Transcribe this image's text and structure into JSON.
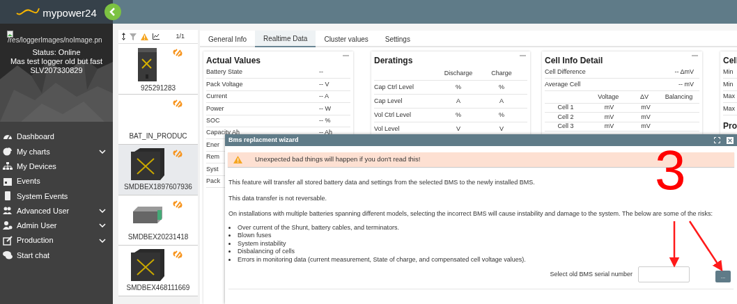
{
  "logo": {
    "text": "mypower24"
  },
  "profile": {
    "image_alt": "/res/loggerImages/noImage.pn",
    "status": "Status: Online",
    "name": "Mas test logger old but fast",
    "serial": "SLV207330829"
  },
  "sidebar": {
    "items": [
      {
        "label": "Dashboard",
        "expandable": false
      },
      {
        "label": "My charts",
        "expandable": true
      },
      {
        "label": "My Devices",
        "expandable": false
      },
      {
        "label": "Events",
        "expandable": false
      },
      {
        "label": "System Events",
        "expandable": false
      },
      {
        "label": "Advanced User",
        "expandable": true
      },
      {
        "label": "Admin User",
        "expandable": true
      },
      {
        "label": "Production",
        "expandable": true
      },
      {
        "label": "Start chat",
        "expandable": false
      }
    ]
  },
  "device_list": {
    "page": "1/1",
    "devices": [
      {
        "name": "925291283",
        "selected": false
      },
      {
        "name": "BAT_IN_PRODUC",
        "selected": false
      },
      {
        "name": "SMDBEX1897607936",
        "selected": true
      },
      {
        "name": "SMDBEX20231418",
        "selected": false
      },
      {
        "name": "SMDBEX468111669",
        "selected": false
      }
    ]
  },
  "tabs": [
    {
      "label": "General Info",
      "selected": false
    },
    {
      "label": "Realtime Data",
      "selected": true
    },
    {
      "label": "Cluster values",
      "selected": false
    },
    {
      "label": "Settings",
      "selected": false
    }
  ],
  "actual_values": {
    "title": "Actual Values",
    "rows": [
      {
        "label": "Battery State",
        "value": "--"
      },
      {
        "label": "Pack Voltage",
        "value": "-- V"
      },
      {
        "label": "Current",
        "value": "-- A"
      },
      {
        "label": "Power",
        "value": "-- W"
      },
      {
        "label": "SOC",
        "value": "-- %"
      },
      {
        "label": "Capacity Ah",
        "value": "-- Ah"
      },
      {
        "label": "Ener"
      },
      {
        "label": "Rem"
      },
      {
        "label": "Syst"
      },
      {
        "label": "Pack"
      }
    ]
  },
  "deratings": {
    "title": "Deratings",
    "columns": [
      "Discharge",
      "Charge"
    ],
    "rows": [
      {
        "label": "Cap Ctrl Level",
        "discharge": "%",
        "charge": "%"
      },
      {
        "label": "Cap Level",
        "discharge": "A",
        "charge": "A"
      },
      {
        "label": "Vol Ctrl Level",
        "discharge": "%",
        "charge": "%"
      },
      {
        "label": "Vol Level",
        "discharge": "V",
        "charge": "V"
      }
    ]
  },
  "cell_info": {
    "title": "Cell Info Detail",
    "summary": [
      {
        "label": "Cell Difference",
        "value": "-- ΔmV"
      },
      {
        "label": "Average Cell",
        "value": "-- mV"
      }
    ],
    "columns": [
      "Voltage",
      "ΔV",
      "Balancing"
    ],
    "cells": [
      {
        "label": "Cell 1",
        "voltage": "mV",
        "delta": "mV"
      },
      {
        "label": "Cell 2",
        "voltage": "mV",
        "delta": "mV"
      },
      {
        "label": "Cell 3",
        "voltage": "mV",
        "delta": "mV"
      }
    ]
  },
  "cell_panel": {
    "title": "Cell",
    "rows": [
      "Min",
      "Min",
      "Max",
      "Max"
    ],
    "section": "Pro"
  },
  "wizard": {
    "title": "Bms replacment wizard",
    "warning": "Unexpected bad things will happen if you don't read this!",
    "paragraphs": [
      "This feature will transfer all stored battery data and settings from the selected BMS to the newly installed BMS.",
      "This data transfer is not reversable.",
      "On installations with multiple batteries spanning different models, selecting the incorrect BMS will cause instability and damage to the system. The below are some of the risks:"
    ],
    "risks": [
      "Over current of the Shunt, battery cables, and terminators.",
      "Blown fuses",
      "System instability",
      "Disbalancing of cells",
      "Errors in monitoring data (current measurement, State of charge, and compensated cell voltage values)."
    ],
    "serial_label": "Select old BMS serial number",
    "browse_button": "..."
  },
  "annotation": {
    "label": "3"
  }
}
